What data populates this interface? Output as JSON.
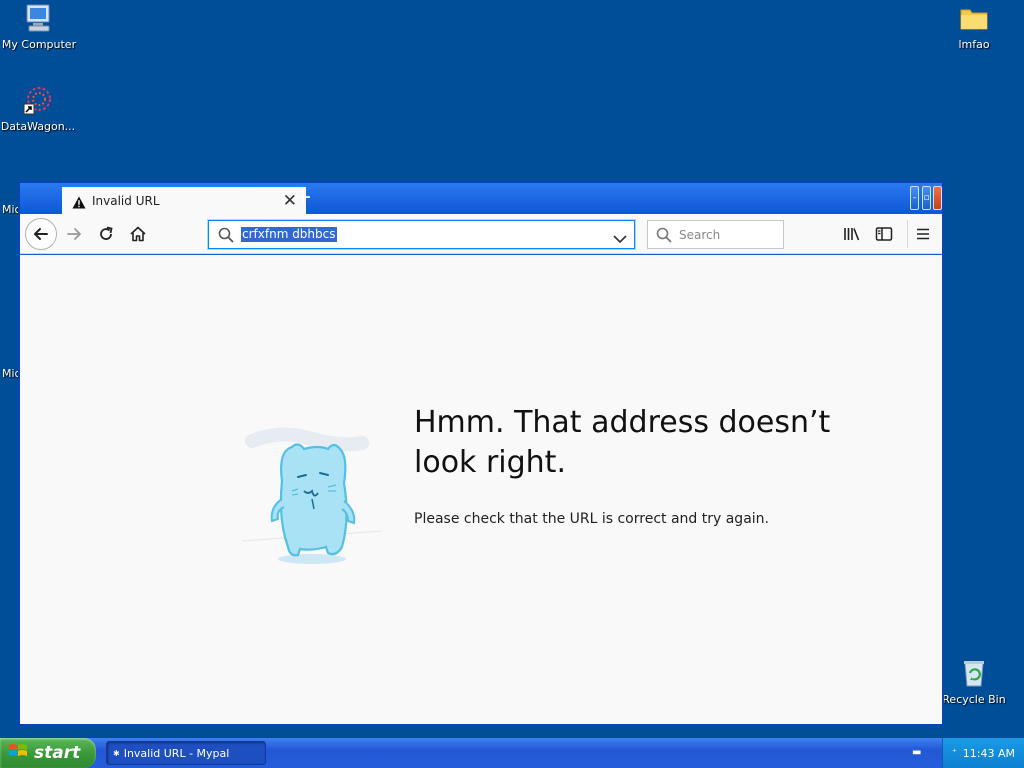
{
  "desktop": {
    "icons": [
      {
        "label": "My Computer",
        "icon": "computer-icon"
      },
      {
        "label": "DataWagon...",
        "icon": "datawagon-icon"
      },
      {
        "label": "lmfao",
        "icon": "folder-icon"
      },
      {
        "label": "Recycle Bin",
        "icon": "recycle-bin-icon"
      }
    ],
    "peek_labels": [
      "Mic",
      "Mic"
    ]
  },
  "browser": {
    "tab": {
      "title": "Invalid URL",
      "icon": "warning-icon"
    },
    "new_tab_symbol": "+",
    "url_text": "crfxfnm dbhbcs",
    "search_placeholder": "Search",
    "error": {
      "title": "Hmm. That address doesn’t look right.",
      "description": "Please check that the URL is correct and try again."
    }
  },
  "taskbar": {
    "start_label": "start",
    "task_label": "Invalid URL - Mypal",
    "clock": "11:43 AM"
  },
  "colors": {
    "desktop": "#004e98",
    "accent": "#0a84ff",
    "selection": "#3367d6"
  }
}
